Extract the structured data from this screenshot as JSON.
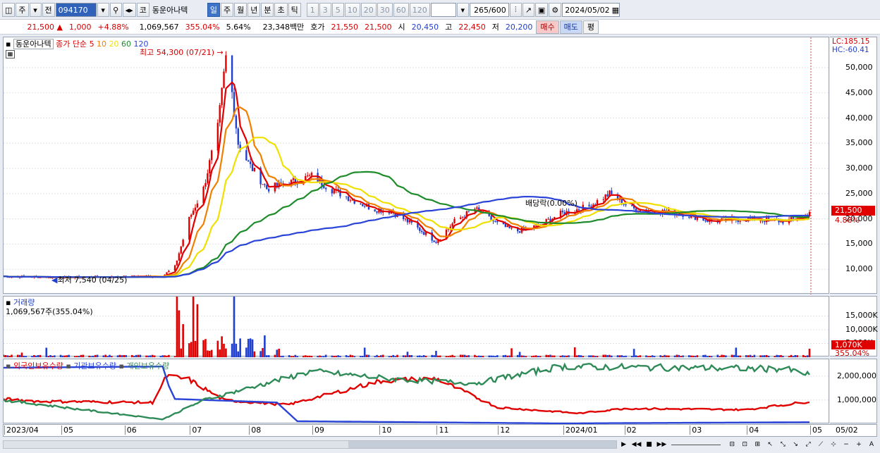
{
  "toolbar": {
    "market": "주",
    "mode": "전",
    "code": "094170",
    "code_btn": "코",
    "stock_name": "동운아나텍",
    "periods": [
      "일",
      "주",
      "월",
      "년",
      "분",
      "초",
      "틱"
    ],
    "selected_period": "일",
    "intervals": [
      "1",
      "3",
      "5",
      "10",
      "20",
      "30",
      "60",
      "120"
    ],
    "count": "265",
    "count_max": "/600",
    "date": "2024/05/02"
  },
  "quote": {
    "price": "21,500",
    "arrow": "▲",
    "change": "1,000",
    "pct": "+4.88%",
    "volume": "1,069,567",
    "vol_ratio": "355.04%",
    "turnover": "5.64%",
    "amount": "23,348백만",
    "hoga_label": "호가",
    "ask": "21,550",
    "bid": "21,500",
    "open_label": "시",
    "open": "20,450",
    "high_label": "고",
    "high": "22,450",
    "low_label": "저",
    "low": "20,200",
    "buy_btn": "매수",
    "sell_btn": "매도",
    "eval_btn": "평"
  },
  "price_panel": {
    "name": "동운아나텍",
    "ma_label": "종가 단순",
    "ma_periods": [
      "5",
      "10",
      "20",
      "60",
      "120"
    ],
    "ma_colors": [
      "#e00000",
      "#f08000",
      "#f0e000",
      "#1e8c2a",
      "#2a44d8"
    ],
    "high_note": "최고 54,300 (07/21)",
    "low_note": "최저 7,540 (04/25)",
    "div_note": "배당락(0.00%)",
    "lc": "LC:185.15",
    "hc": "HC:-60.41",
    "last_price": "21,500",
    "last_pct": "4.88%",
    "ticks": [
      "50,000",
      "45,000",
      "40,000",
      "35,000",
      "30,000",
      "25,000",
      "20,000",
      "15,000",
      "10,000"
    ]
  },
  "volume_panel": {
    "title": "거래량",
    "value": "1,069,567주(355.04%)",
    "ticks": [
      "15,000K",
      "10,000K",
      "5,000K"
    ],
    "last": "1,070K",
    "last_pct": "355.04%"
  },
  "holding_panel": {
    "series": [
      "외국인보유수량",
      "기관보유수량",
      "개인보유수량"
    ],
    "colors": [
      "#e00000",
      "#2a44d8",
      "#2e8b57"
    ],
    "ticks": [
      "2,000,000",
      "1,000,000"
    ]
  },
  "x_labels": [
    "2023/04",
    "05",
    "06",
    "07",
    "08",
    "09",
    "10",
    "11",
    "12",
    "2024/01",
    "02",
    "03",
    "04",
    "05"
  ],
  "x_right": "05/02",
  "chart_data": {
    "type": "line",
    "x_range": [
      "2023/04/03",
      "2024/05/02"
    ],
    "ylim": [
      5000,
      56000
    ],
    "price_series_close": [
      [
        "2023/04/03",
        8600
      ],
      [
        "2023/05/01",
        8400
      ],
      [
        "2023/06/01",
        8500
      ],
      [
        "2023/06/20",
        8700
      ],
      [
        "2023/06/26",
        10500
      ],
      [
        "2023/07/03",
        20000
      ],
      [
        "2023/07/10",
        26000
      ],
      [
        "2023/07/17",
        38000
      ],
      [
        "2023/07/21",
        52000
      ],
      [
        "2023/07/24",
        45000
      ],
      [
        "2023/07/27",
        35000
      ],
      [
        "2023/08/01",
        31000
      ],
      [
        "2023/08/10",
        26000
      ],
      [
        "2023/08/20",
        27000
      ],
      [
        "2023/09/01",
        28500
      ],
      [
        "2023/09/10",
        26000
      ],
      [
        "2023/09/20",
        24000
      ],
      [
        "2023/10/01",
        22000
      ],
      [
        "2023/10/10",
        21500
      ],
      [
        "2023/10/20",
        19000
      ],
      [
        "2023/11/01",
        15500
      ],
      [
        "2023/11/10",
        19500
      ],
      [
        "2023/11/20",
        22000
      ],
      [
        "2023/12/01",
        19000
      ],
      [
        "2023/12/10",
        17500
      ],
      [
        "2023/12/20",
        18500
      ],
      [
        "2024/01/01",
        21000
      ],
      [
        "2024/01/15",
        22500
      ],
      [
        "2024/01/25",
        25000
      ],
      [
        "2024/02/05",
        22000
      ],
      [
        "2024/02/20",
        21500
      ],
      [
        "2024/03/01",
        21000
      ],
      [
        "2024/03/15",
        19500
      ],
      [
        "2024/04/01",
        20000
      ],
      [
        "2024/04/20",
        19500
      ],
      [
        "2024/04/30",
        20500
      ],
      [
        "2024/05/02",
        21500
      ]
    ],
    "holding_series": {
      "외국인보유수량": [
        [
          "2023/04/03",
          1050000
        ],
        [
          "2023/04/20",
          950000
        ],
        [
          "2023/06/15",
          900000
        ],
        [
          "2023/06/22",
          2000000
        ],
        [
          "2023/07/03",
          1850000
        ],
        [
          "2023/07/20",
          1000000
        ],
        [
          "2023/08/20",
          800000
        ],
        [
          "2023/10/05",
          1800000
        ],
        [
          "2023/11/01",
          1900000
        ],
        [
          "2023/12/01",
          700000
        ],
        [
          "2024/01/10",
          450000
        ],
        [
          "2024/02/01",
          650000
        ],
        [
          "2024/04/01",
          600000
        ],
        [
          "2024/04/28",
          900000
        ],
        [
          "2024/05/02",
          950000
        ]
      ],
      "기관보유수량": [
        [
          "2023/04/03",
          2350000
        ],
        [
          "2023/06/20",
          2400000
        ],
        [
          "2023/06/25",
          1050000
        ],
        [
          "2023/08/15",
          900000
        ],
        [
          "2023/08/25",
          120000
        ],
        [
          "2024/01/01",
          30000
        ],
        [
          "2024/05/02",
          80000
        ]
      ],
      "개인보유수량": [
        [
          "2023/04/03",
          1000000
        ],
        [
          "2023/06/20",
          200000
        ],
        [
          "2023/07/10",
          1000000
        ],
        [
          "2023/09/01",
          2200000
        ],
        [
          "2023/10/15",
          1850000
        ],
        [
          "2023/11/20",
          1700000
        ],
        [
          "2024/01/01",
          2400000
        ],
        [
          "2024/04/20",
          2300000
        ],
        [
          "2024/05/02",
          2050000
        ]
      ]
    }
  }
}
